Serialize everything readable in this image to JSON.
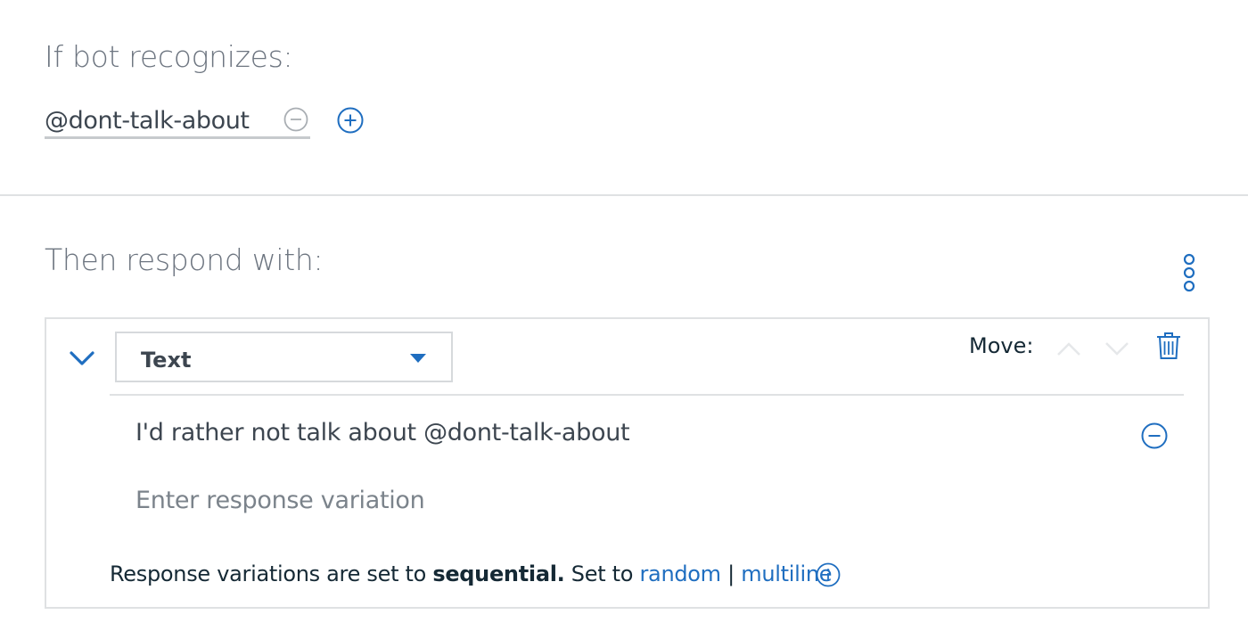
{
  "condition": {
    "title": "If bot recognizes:",
    "entity": "@dont-talk-about",
    "remove_icon": "minus-circle-icon",
    "add_icon": "plus-circle-icon"
  },
  "response": {
    "title": "Then respond with:",
    "menu_icon": "vertical-kebab-icon",
    "type_selected": "Text",
    "move_label": "Move:",
    "variations": [
      "I'd rather not talk about @dont-talk-about"
    ],
    "new_variation_placeholder": "Enter response variation",
    "footer": {
      "prefix": "Response variations are set to ",
      "mode": "sequential.",
      "set_to": " Set to ",
      "option_random": "random",
      "separator": "|",
      "option_multiline": "multiline"
    }
  },
  "colors": {
    "accent": "#1f6ec0",
    "muted_icon": "#a9aeb3",
    "divider": "#dfe1e3",
    "heading": "#6d7580"
  }
}
